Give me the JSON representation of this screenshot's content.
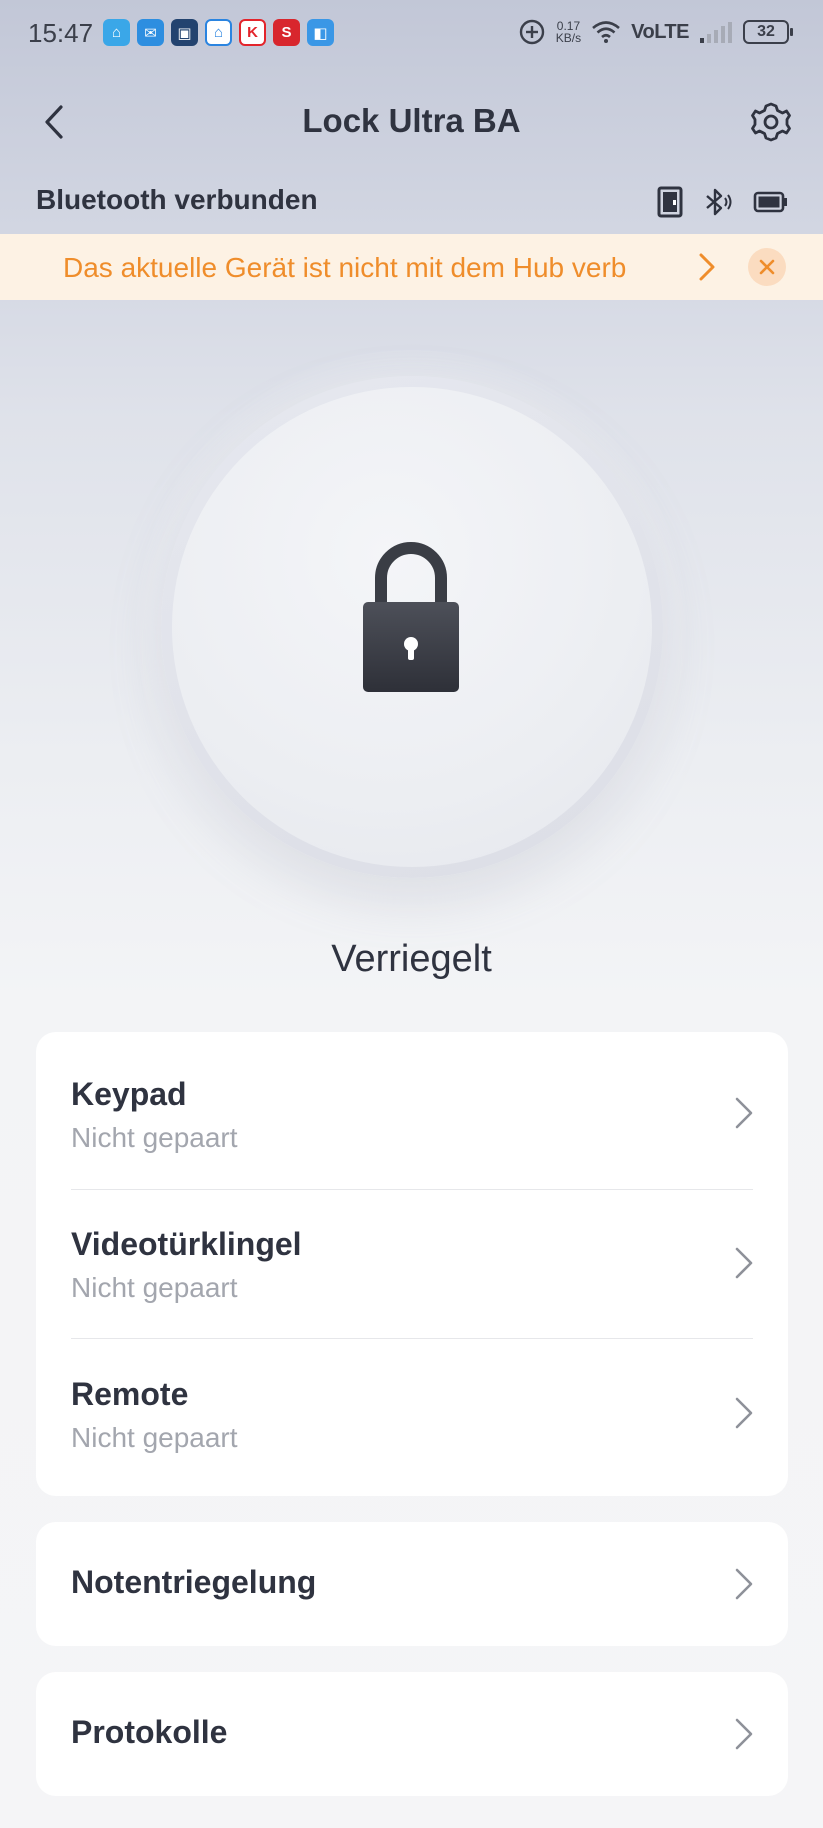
{
  "status_bar": {
    "time": "15:47",
    "notification_icons": [
      {
        "icon": "home-app-icon",
        "color": "#3aa7e8",
        "glyph": "⌂"
      },
      {
        "icon": "mail-icon",
        "color": "#2d8ee0",
        "glyph": "✉"
      },
      {
        "icon": "video-app-icon",
        "color": "#23436f",
        "glyph": "▣"
      },
      {
        "icon": "smart-home-icon",
        "color": "#2a84e0",
        "glyph": "⌂"
      },
      {
        "icon": "kaufland-icon",
        "color": "#e3242b",
        "glyph": "K"
      },
      {
        "icon": "s-app-icon",
        "color": "#d8262d",
        "glyph": "S"
      },
      {
        "icon": "app-icon",
        "color": "#3a97e6",
        "glyph": "◧"
      }
    ],
    "speed_value": "0.17",
    "speed_unit": "KB/s",
    "network": "VoLTE",
    "battery": "32"
  },
  "header": {
    "title": "Lock Ultra BA"
  },
  "connection": {
    "label": "Bluetooth verbunden"
  },
  "banner": {
    "text": "Das aktuelle Gerät ist nicht mit dem Hub verb",
    "accent_color": "#ef8d2b"
  },
  "lock": {
    "status": "Verriegelt"
  },
  "devices": [
    {
      "title": "Keypad",
      "subtitle": "Nicht gepaart"
    },
    {
      "title": "Videotürklingel",
      "subtitle": "Nicht gepaart"
    },
    {
      "title": "Remote",
      "subtitle": "Nicht gepaart"
    }
  ],
  "emergency": {
    "title": "Notentriegelung"
  },
  "logs": {
    "title": "Protokolle"
  }
}
